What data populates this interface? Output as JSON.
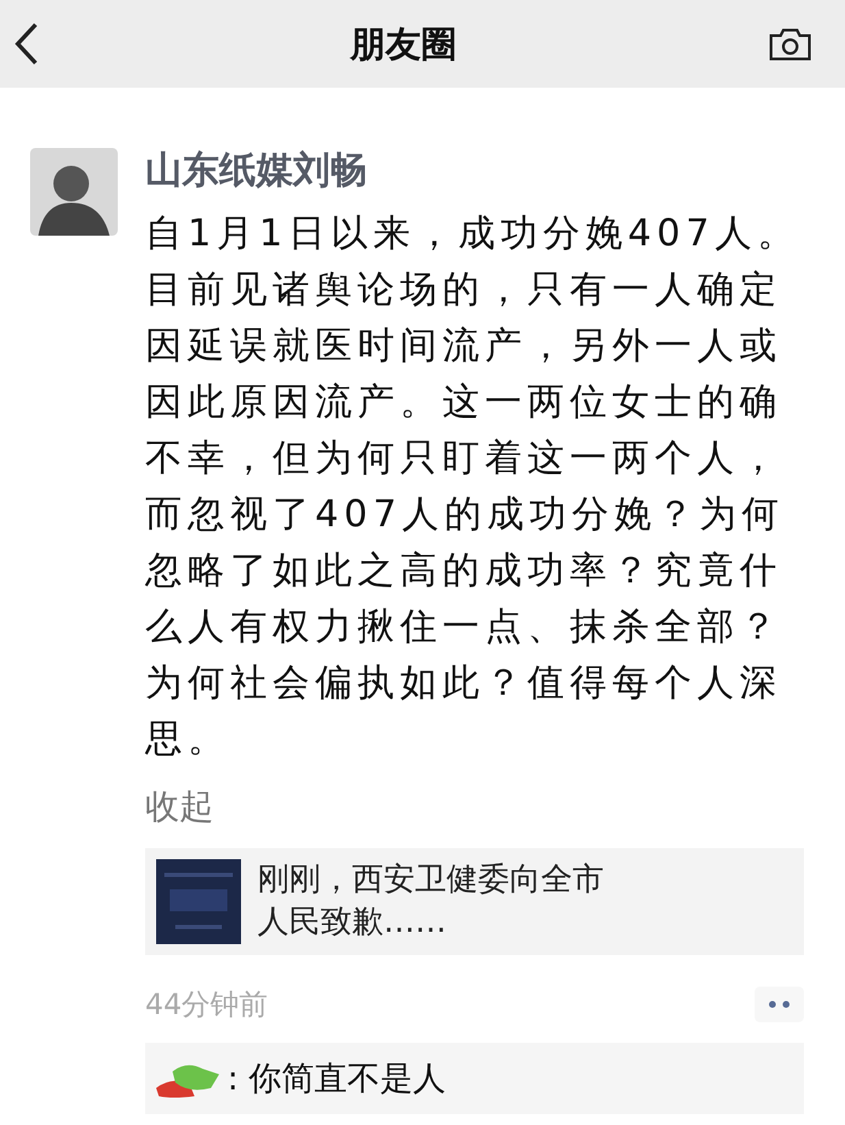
{
  "nav": {
    "title": "朋友圈"
  },
  "post": {
    "author": "山东纸媒刘畅",
    "text": "自1月1日以来，成功分娩407人。目前见诸舆论场的，只有一人确定因延误就医时间流产，另外一人或因此原因流产。这一两位女士的确不幸，但为何只盯着这一两个人，而忽视了407人的成功分娩？为何忽略了如此之高的成功率？究竟什么人有权力揪住一点、抹杀全部？为何社会偏执如此？值得每个人深思。",
    "collapse": "收起",
    "link": {
      "title": "刚刚，西安卫健委向全市人民致歉……"
    },
    "time": "44分钟前",
    "comments": [
      {
        "text": ": 你简直不是人",
        "name_redacted": true
      }
    ]
  }
}
